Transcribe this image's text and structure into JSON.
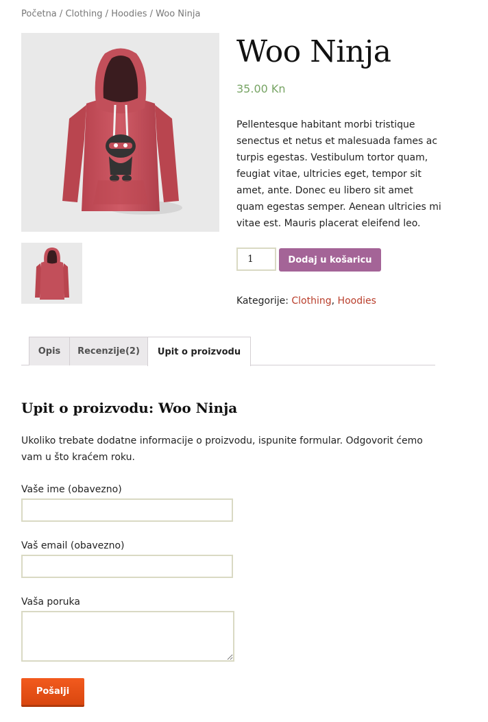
{
  "breadcrumb": {
    "home": "Početna",
    "sep1": " / ",
    "category": "Clothing",
    "sep2": " / ",
    "subcategory": "Hoodies",
    "sep3": " / ",
    "current": "Woo Ninja"
  },
  "product": {
    "title": "Woo Ninja",
    "price": "35.00 Kn",
    "description": "Pellentesque habitant morbi tristique senectus et netus et malesuada fames ac turpis egestas. Vestibulum tortor quam, feugiat vitae, ultricies eget, tempor sit amet, ante. Donec eu libero sit amet quam egestas semper. Aenean ultricies mi vitae est. Mauris placerat eleifend leo.",
    "quantity": "1",
    "add_to_cart_label": "Dodaj u košaricu",
    "categories_label": "Kategorije: ",
    "categories": [
      "Clothing",
      "Hoodies"
    ],
    "categories_sep": ", ",
    "image_icon": "hoodie-image",
    "colors": {
      "hoodie": "#c9545f",
      "price": "#77a464",
      "button": "#a46497",
      "link": "#b93e2b",
      "submit": "#e8531a"
    }
  },
  "tabs": [
    {
      "label": "Opis",
      "active": false
    },
    {
      "label": "Recenzije(2)",
      "active": false
    },
    {
      "label": "Upit o proizvodu",
      "active": true
    }
  ],
  "enquiry": {
    "title": "Upit o proizvodu: Woo Ninja",
    "intro": "Ukoliko trebate dodatne informacije o proizvodu, ispunite formular. Odgovorit ćemo vam u što kraćem roku.",
    "name_label": "Vaše ime (obavezno)",
    "name_value": "",
    "email_label": "Vaš email (obavezno)",
    "email_value": "",
    "message_label": "Vaša poruka",
    "message_value": "",
    "submit_label": "Pošalji"
  }
}
